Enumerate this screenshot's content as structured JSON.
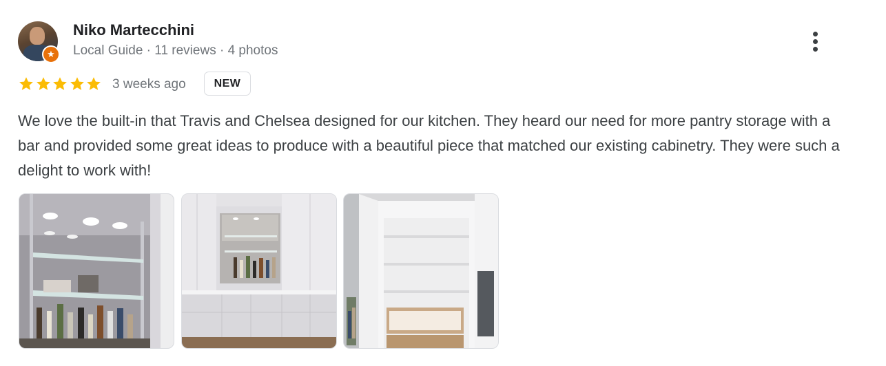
{
  "reviewer": {
    "name": "Niko Martecchini",
    "meta": "Local Guide · 11 reviews · 4 photos",
    "badge_icon": "★"
  },
  "rating": {
    "stars": 5,
    "max": 5,
    "star_color": "#fbbc04"
  },
  "time_ago": "3 weeks ago",
  "badge": "NEW",
  "review_text": "We love the built-in that Travis and Chelsea designed for our kitchen. They heard our need for more pantry storage with a bar and provided some great ideas to produce with a beautiful piece that matched our existing cabinetry. They were such a delight to work with!",
  "photos": [
    {
      "subject": "bar-shelves-icon"
    },
    {
      "subject": "cabinet-wall-icon"
    },
    {
      "subject": "pantry-open-icon"
    }
  ]
}
